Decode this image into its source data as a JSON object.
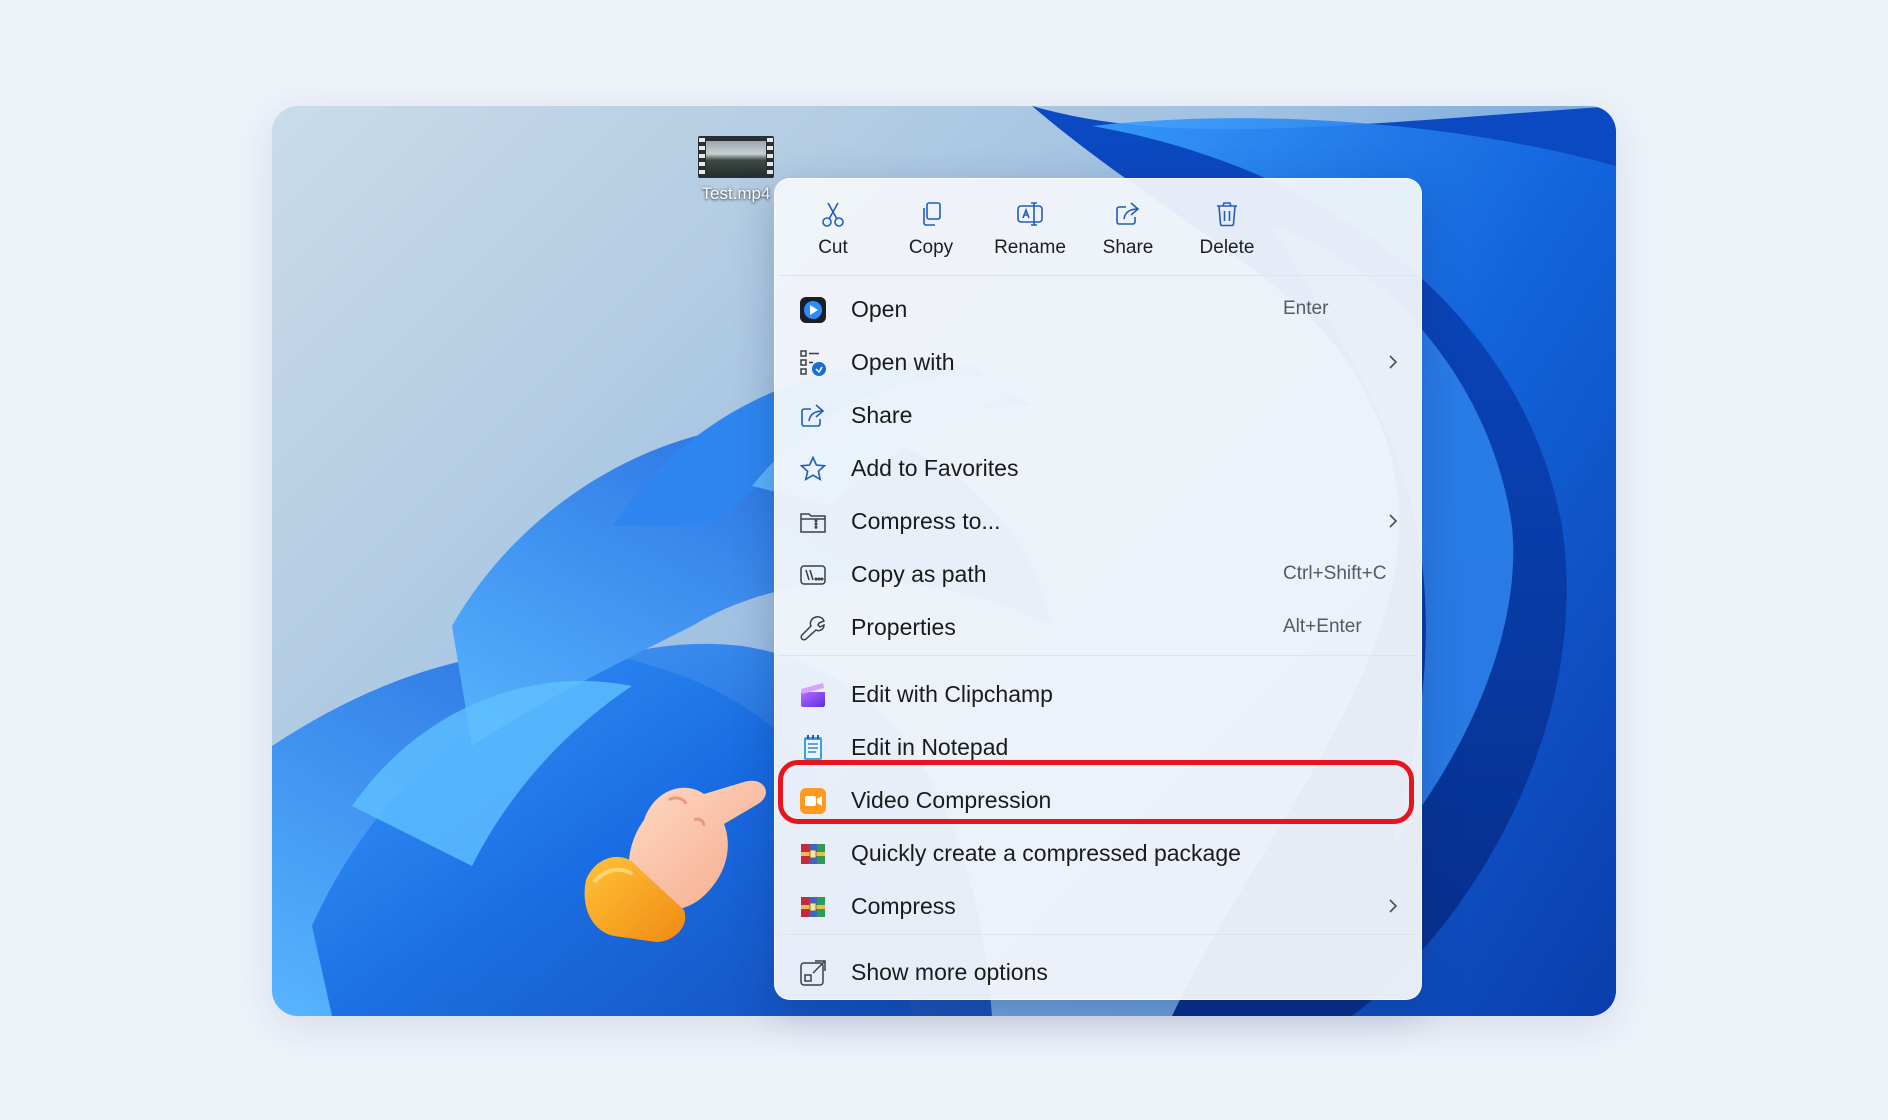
{
  "desktop": {
    "file": {
      "name": "Test.mp4",
      "icon": "video-file-thumbnail-icon"
    }
  },
  "toolbar": {
    "buttons": [
      {
        "label": "Cut",
        "icon": "scissors-icon"
      },
      {
        "label": "Copy",
        "icon": "copy-icon"
      },
      {
        "label": "Rename",
        "icon": "rename-icon"
      },
      {
        "label": "Share",
        "icon": "share-icon"
      },
      {
        "label": "Delete",
        "icon": "trash-icon"
      }
    ]
  },
  "menu": {
    "items": [
      {
        "label": "Open",
        "shortcut": "Enter",
        "icon": "media-player-icon"
      },
      {
        "label": "Open with",
        "shortcut": "",
        "icon": "open-with-icon",
        "submenu": true
      },
      {
        "label": "Share",
        "shortcut": "",
        "icon": "share-icon"
      },
      {
        "label": "Add to Favorites",
        "shortcut": "",
        "icon": "star-icon"
      },
      {
        "label": "Compress to...",
        "shortcut": "",
        "icon": "zip-folder-icon",
        "submenu": true
      },
      {
        "label": "Copy as path",
        "shortcut": "Ctrl+Shift+C",
        "icon": "path-icon"
      },
      {
        "label": "Properties",
        "shortcut": "Alt+Enter",
        "icon": "wrench-icon"
      }
    ],
    "app_items": [
      {
        "label": "Edit with Clipchamp",
        "icon": "clipchamp-icon"
      },
      {
        "label": "Edit in Notepad",
        "icon": "notepad-icon"
      },
      {
        "label": "Video Compression",
        "icon": "video-compression-icon",
        "highlighted": true
      },
      {
        "label": "Quickly create a compressed package",
        "icon": "archive-icon"
      },
      {
        "label": "Compress",
        "icon": "archive-icon",
        "submenu": true
      }
    ],
    "footer": {
      "label": "Show more options",
      "icon": "show-more-icon"
    }
  },
  "colors": {
    "highlight": "#e8141b",
    "icon_blue": "#1a6fd1"
  }
}
